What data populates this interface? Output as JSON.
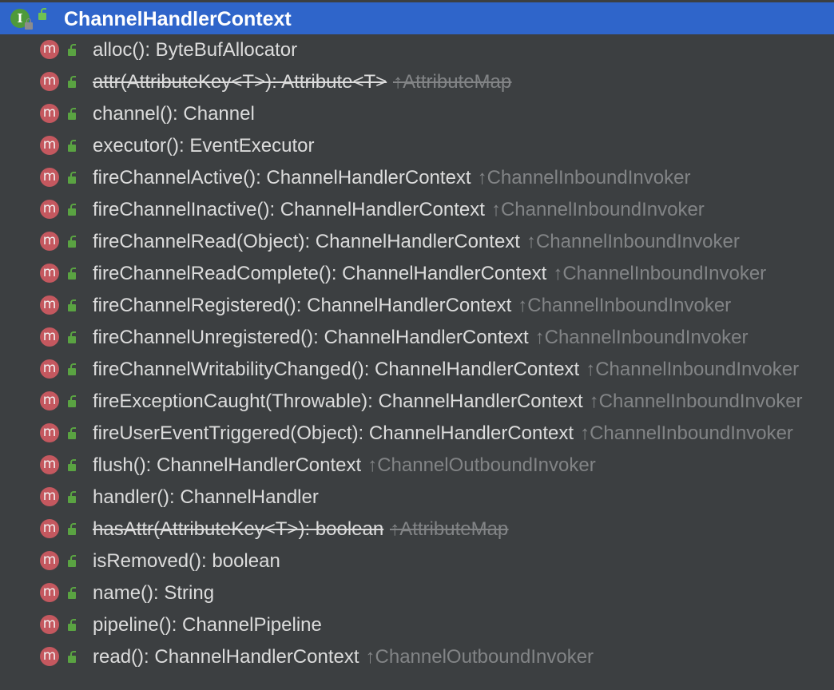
{
  "header": {
    "title": "ChannelHandlerContext",
    "icon_letter": "I",
    "icon": "interface-icon",
    "visibility_icon": "public-lock-icon"
  },
  "method_icon_letter": "m",
  "colors": {
    "selection": "#2f65ca",
    "background": "#3c3f41",
    "method_icon": "#c4585f",
    "public_lock": "#5aa342",
    "text": "#dcdcdc",
    "inherited": "#828486"
  },
  "methods": [
    {
      "signature": "alloc(): ByteBufAllocator",
      "origin": "",
      "deprecated": false
    },
    {
      "signature": "attr(AttributeKey<T>): Attribute<T>",
      "origin": "↑AttributeMap",
      "deprecated": true
    },
    {
      "signature": "channel(): Channel",
      "origin": "",
      "deprecated": false
    },
    {
      "signature": "executor(): EventExecutor",
      "origin": "",
      "deprecated": false
    },
    {
      "signature": "fireChannelActive(): ChannelHandlerContext",
      "origin": "↑ChannelInboundInvoker",
      "deprecated": false
    },
    {
      "signature": "fireChannelInactive(): ChannelHandlerContext",
      "origin": "↑ChannelInboundInvoker",
      "deprecated": false
    },
    {
      "signature": "fireChannelRead(Object): ChannelHandlerContext",
      "origin": "↑ChannelInboundInvoker",
      "deprecated": false
    },
    {
      "signature": "fireChannelReadComplete(): ChannelHandlerContext",
      "origin": "↑ChannelInboundInvoker",
      "deprecated": false
    },
    {
      "signature": "fireChannelRegistered(): ChannelHandlerContext",
      "origin": "↑ChannelInboundInvoker",
      "deprecated": false
    },
    {
      "signature": "fireChannelUnregistered(): ChannelHandlerContext",
      "origin": "↑ChannelInboundInvoker",
      "deprecated": false
    },
    {
      "signature": "fireChannelWritabilityChanged(): ChannelHandlerContext",
      "origin": "↑ChannelInboundInvoker",
      "deprecated": false
    },
    {
      "signature": "fireExceptionCaught(Throwable): ChannelHandlerContext",
      "origin": "↑ChannelInboundInvoker",
      "deprecated": false
    },
    {
      "signature": "fireUserEventTriggered(Object): ChannelHandlerContext",
      "origin": "↑ChannelInboundInvoker",
      "deprecated": false
    },
    {
      "signature": "flush(): ChannelHandlerContext",
      "origin": "↑ChannelOutboundInvoker",
      "deprecated": false
    },
    {
      "signature": "handler(): ChannelHandler",
      "origin": "",
      "deprecated": false
    },
    {
      "signature": "hasAttr(AttributeKey<T>): boolean",
      "origin": "↑AttributeMap",
      "deprecated": true
    },
    {
      "signature": "isRemoved(): boolean",
      "origin": "",
      "deprecated": false
    },
    {
      "signature": "name(): String",
      "origin": "",
      "deprecated": false
    },
    {
      "signature": "pipeline(): ChannelPipeline",
      "origin": "",
      "deprecated": false
    },
    {
      "signature": "read(): ChannelHandlerContext",
      "origin": "↑ChannelOutboundInvoker",
      "deprecated": false
    }
  ]
}
